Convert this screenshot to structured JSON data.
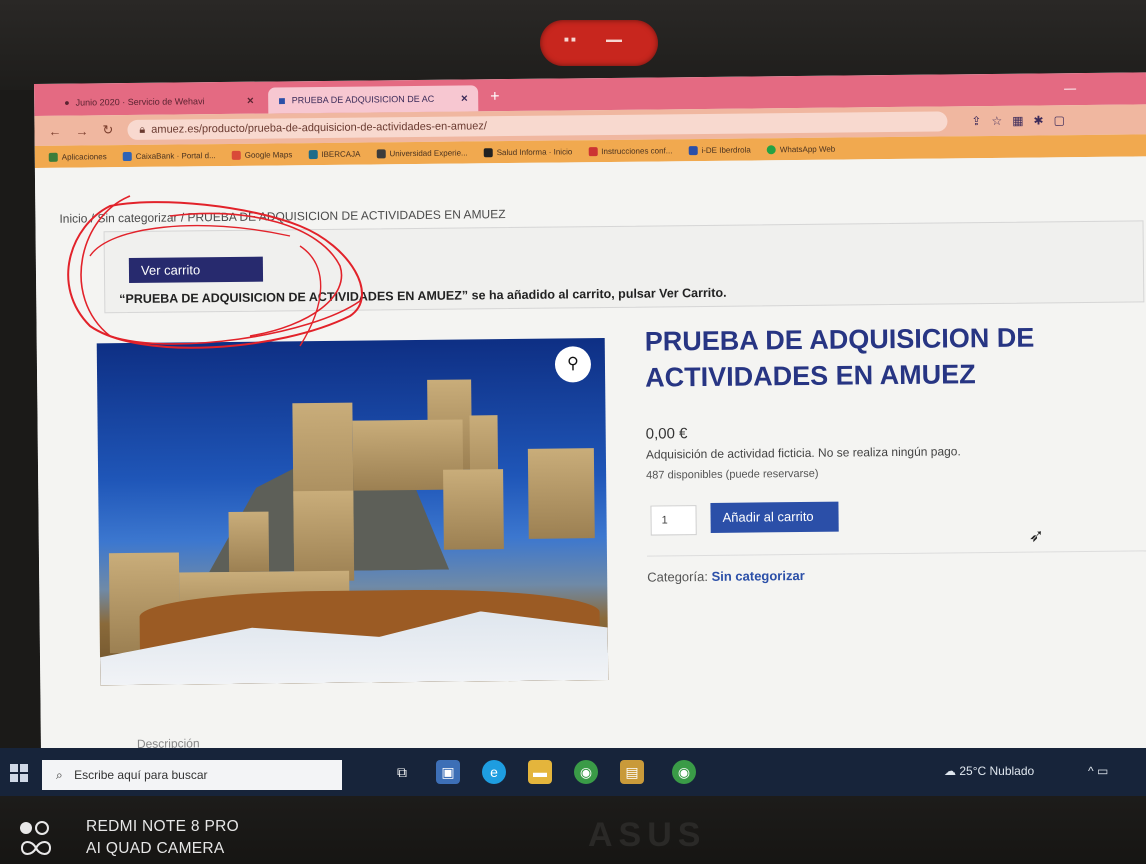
{
  "browser": {
    "tabs": [
      {
        "label": "Junio 2020 · Servicio de Wehavi",
        "active": false
      },
      {
        "label": "PRUEBA DE ADQUISICION DE AC",
        "active": true
      }
    ],
    "url": "amuez.es/producto/prueba-de-adquisicion-de-actividades-en-amuez/",
    "bookmarks": [
      "Aplicaciones",
      "CaixaBank · Portal d...",
      "Google Maps",
      "IBERCAJA",
      "Universidad Experie...",
      "Salud Informa · Inicio",
      "Instrucciones conf...",
      "i-DE Iberdrola",
      "WhatsApp Web"
    ]
  },
  "page": {
    "breadcrumb": "Inicio / Sin categorizar / PRUEBA DE ADQUISICION DE ACTIVIDADES EN AMUEZ",
    "notice": {
      "button_label": "Ver carrito",
      "message": "“PRUEBA DE ADQUISICION DE ACTIVIDADES EN AMUEZ” se ha añadido al carrito, pulsar Ver Carrito."
    },
    "product": {
      "title": "PRUEBA DE ADQUISICION DE ACTIVIDADES EN AMUEZ",
      "price": "0,00 €",
      "description": "Adquisición de actividad ficticia. No se realiza ningún pago.",
      "stock": "487 disponibles (puede reservarse)",
      "quantity": "1",
      "add_to_cart_label": "Añadir al carrito",
      "category_label": "Categoría:",
      "category_value": "Sin categorizar"
    },
    "below_fold": "Descripción"
  },
  "taskbar": {
    "search_placeholder": "Escribe aquí para buscar",
    "weather": "25°C  Nublado"
  },
  "watermark": {
    "line1": "REDMI NOTE 8 PRO",
    "line2": "AI QUAD CAMERA"
  },
  "bezel": {
    "brand": "ASUS"
  },
  "colors": {
    "title_blue": "#273583",
    "button_blue": "#2b4fa8",
    "cart_button": "#272a6e",
    "tabbar": "#e46a82",
    "bookmarks_bar": "#f1a94f",
    "scribble": "#e2222a"
  }
}
